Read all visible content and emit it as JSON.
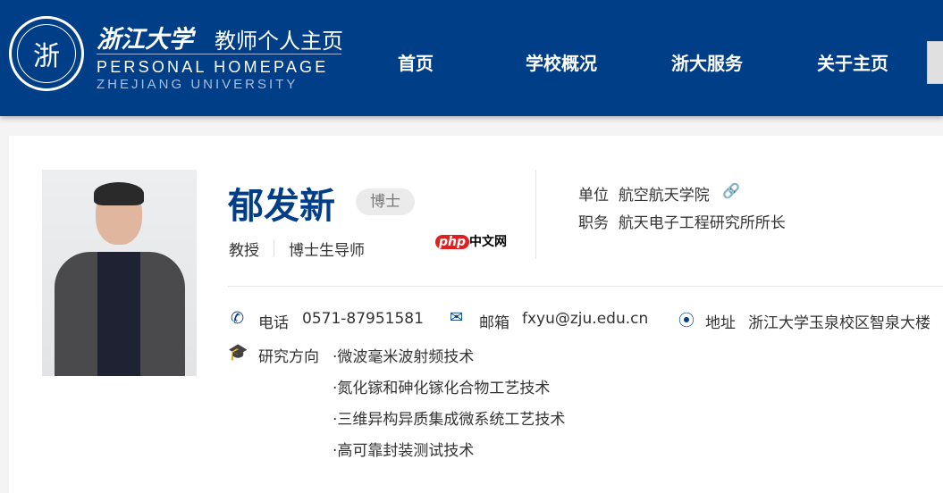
{
  "header": {
    "seal_text": "浙",
    "brand_cn": "浙江大学",
    "brand_sub": "教师个人主页",
    "brand_en1": "PERSONAL HOMEPAGE",
    "brand_en2": "ZHEJIANG UNIVERSITY",
    "nav": [
      "首页",
      "学校概况",
      "浙大服务",
      "关于主页"
    ]
  },
  "profile": {
    "name": "郁发新",
    "degree": "博士",
    "titles": [
      "教授",
      "博士生导师"
    ],
    "unit_label": "单位",
    "unit": "航空航天学院",
    "position_label": "职务",
    "position": "航天电子工程研究所所长",
    "phone_label": "电话",
    "phone": "0571-87951581",
    "email_label": "邮箱",
    "email": "fxyu@zju.edu.cn",
    "address_label": "地址",
    "address": "浙江大学玉泉校区智泉大楼",
    "research_label": "研究方向",
    "research": [
      "·微波毫米波射频技术",
      "·氮化镓和砷化镓化合物工艺技术",
      "·三维异构异质集成微系统工艺技术",
      "·高可靠封装测试技术"
    ]
  },
  "watermark": {
    "p": "php",
    "t": "中文网"
  }
}
